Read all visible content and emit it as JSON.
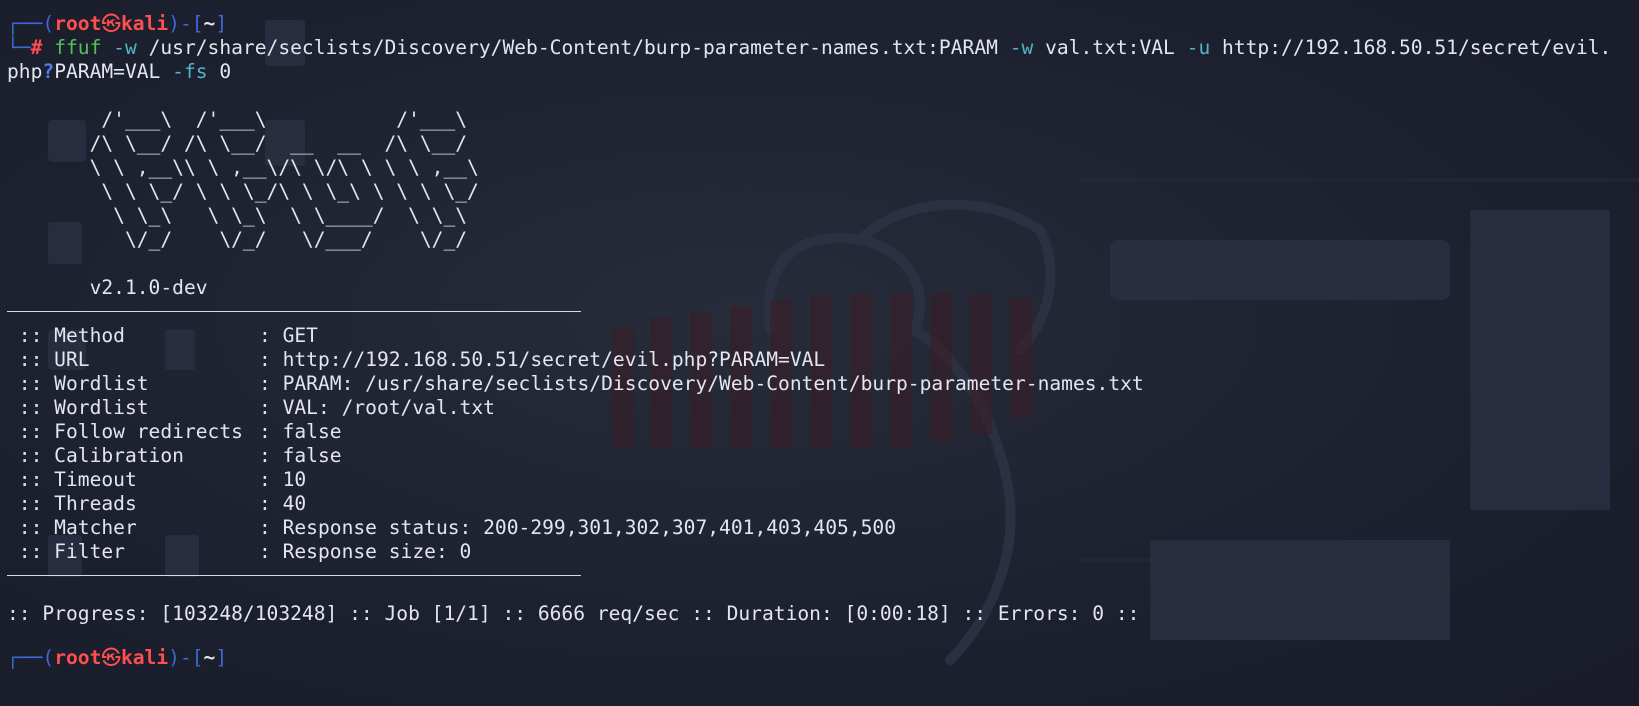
{
  "prompt": {
    "corner_top": "┌──(",
    "user": "root",
    "at_symbol": "㉿",
    "host": "kali",
    "mid": ")-[",
    "cwd": "~",
    "end": "]",
    "corner_bottom": "└─",
    "hash": "#"
  },
  "command": {
    "program": "ffuf",
    "flag_w1": "-w",
    "wordlist1": "/usr/share/seclists/Discovery/Web-Content/burp-parameter-names.txt:PARAM",
    "flag_w2": "-w",
    "wordlist2": "val.txt:VAL",
    "flag_u": "-u",
    "url_part1": "http://192.168.50.51/secret/evil.",
    "url_part2": "php",
    "url_q": "?",
    "url_part3": "PARAM=VAL",
    "flag_fs": "-fs",
    "fs_value": "0"
  },
  "banner": {
    "art": [
      "        /'___\\  /'___\\           /'___\\",
      "       /\\ \\__/ /\\ \\__/  __  __  /\\ \\__/",
      "       \\ \\ ,__\\\\ \\ ,__\\/\\ \\/\\ \\ \\ \\ ,__\\",
      "        \\ \\ \\_/ \\ \\ \\_/\\ \\ \\_\\ \\ \\ \\ \\_/",
      "         \\ \\_\\   \\ \\_\\  \\ \\____/  \\ \\_\\",
      "          \\/_/    \\/_/   \\/___/    \\/_/"
    ],
    "version": "       v2.1.0-dev"
  },
  "config": [
    {
      "key": " :: Method",
      "value": ": GET"
    },
    {
      "key": " :: URL",
      "value": ": http://192.168.50.51/secret/evil.php?PARAM=VAL"
    },
    {
      "key": " :: Wordlist",
      "value": ": PARAM: /usr/share/seclists/Discovery/Web-Content/burp-parameter-names.txt"
    },
    {
      "key": " :: Wordlist",
      "value": ": VAL: /root/val.txt"
    },
    {
      "key": " :: Follow redirects",
      "value": ": false"
    },
    {
      "key": " :: Calibration",
      "value": ": false"
    },
    {
      "key": " :: Timeout",
      "value": ": 10"
    },
    {
      "key": " :: Threads",
      "value": ": 40"
    },
    {
      "key": " :: Matcher",
      "value": ": Response status: 200-299,301,302,307,401,403,405,500"
    },
    {
      "key": " :: Filter",
      "value": ": Response size: 0"
    }
  ],
  "progress": {
    "line": ":: Progress: [103248/103248] :: Job [1/1] :: 6666 req/sec :: Duration: [0:00:18] :: Errors: 0 ::"
  },
  "colors": {
    "prompt_bracket": "#3d68d8",
    "prompt_user": "#ff4e4e",
    "command": "#53c256",
    "flag": "#4fb6c9",
    "background": "#1d2130",
    "text": "#e3e6ee"
  }
}
